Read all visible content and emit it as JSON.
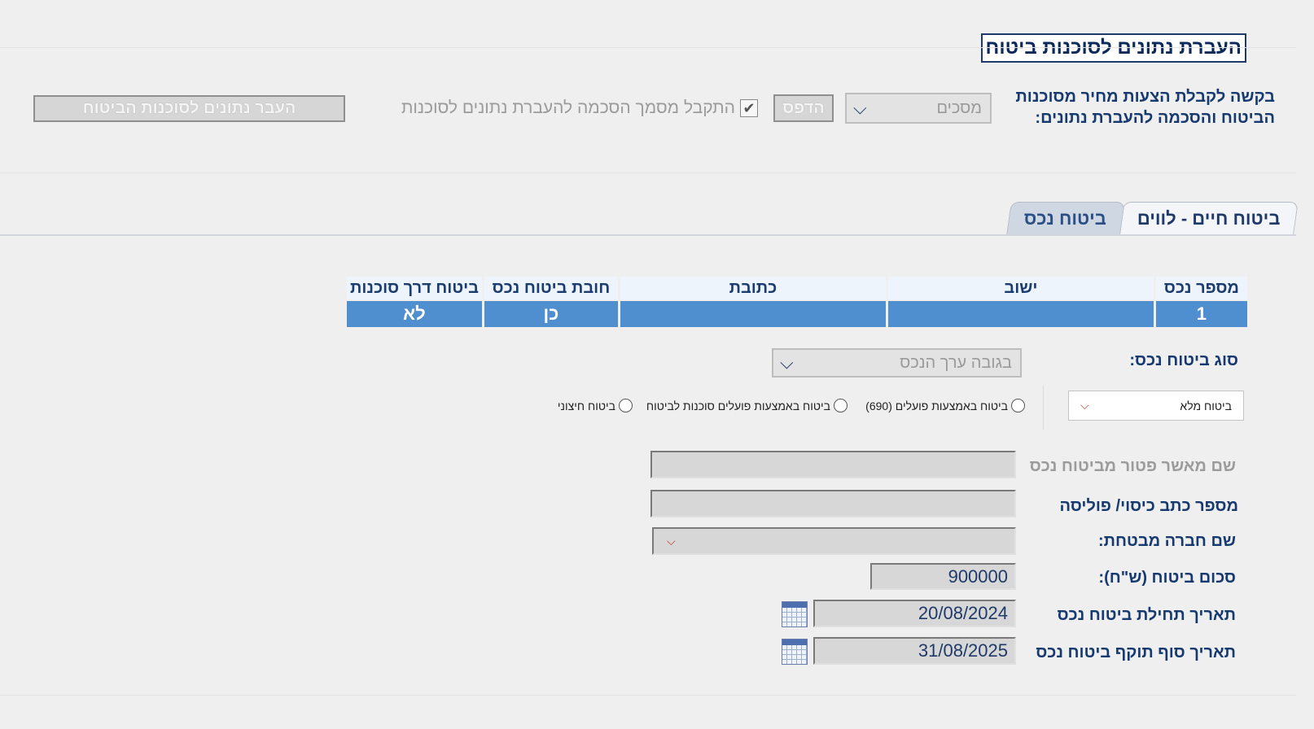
{
  "page_title": "העברת נתונים לסוכנות ביטוח",
  "request": {
    "label": "בקשה לקבלת הצעות מחיר מסוכנות הביטוח והסכמה להעברת נתונים:",
    "consent_value": "מסכים",
    "print_label": "הדפס",
    "checkbox_label": "התקבל מסמך הסכמה להעברת נתונים לסוכנות",
    "checkbox_mark": "✔",
    "transfer_button": "העבר נתונים לסוכנות הביטוח"
  },
  "tabs": [
    {
      "label": "ביטוח חיים - לווים",
      "active": false
    },
    {
      "label": "ביטוח נכס",
      "active": true
    }
  ],
  "table": {
    "headers": [
      "מספר נכס",
      "ישוב",
      "כתובת",
      "חובת ביטוח נכס",
      "ביטוח דרך סוכנות"
    ],
    "rows": [
      [
        "1",
        "",
        "",
        "כן",
        "לא"
      ]
    ]
  },
  "form": {
    "insurance_type_label": "סוג ביטוח נכס:",
    "insurance_type_value": "בגובה ערך הנכס",
    "coverage_value": "ביטוח מלא",
    "radios": [
      {
        "label": "ביטוח באמצעות פועלים (690)"
      },
      {
        "label": "ביטוח באמצעות פועלים סוכנות לביטוח"
      },
      {
        "label": "ביטוח חיצוני"
      }
    ],
    "exempt_approver_label": "שם מאשר פטור מביטוח נכס",
    "exempt_approver_value": "",
    "policy_number_label": "מספר כתב כיסוי/ פוליסה",
    "policy_number_value": "",
    "insurer_label": "שם חברה מבטחת:",
    "insurer_value": "",
    "amount_label": "סכום ביטוח (ש\"ח):",
    "amount_value": "900000",
    "start_date_label": "תאריך תחילת ביטוח נכס",
    "start_date_value": "20/08/2024",
    "end_date_label": "תאריך סוף תוקף ביטוח נכס",
    "end_date_value": "31/08/2025"
  },
  "icons": {
    "chevron": "chevron-down-icon",
    "calendar": "calendar-icon",
    "check": "check-icon"
  },
  "colors": {
    "accent_blue": "#4f8fd0",
    "title_navy": "#1f3a68",
    "dropdown_red": "#c0392b"
  }
}
